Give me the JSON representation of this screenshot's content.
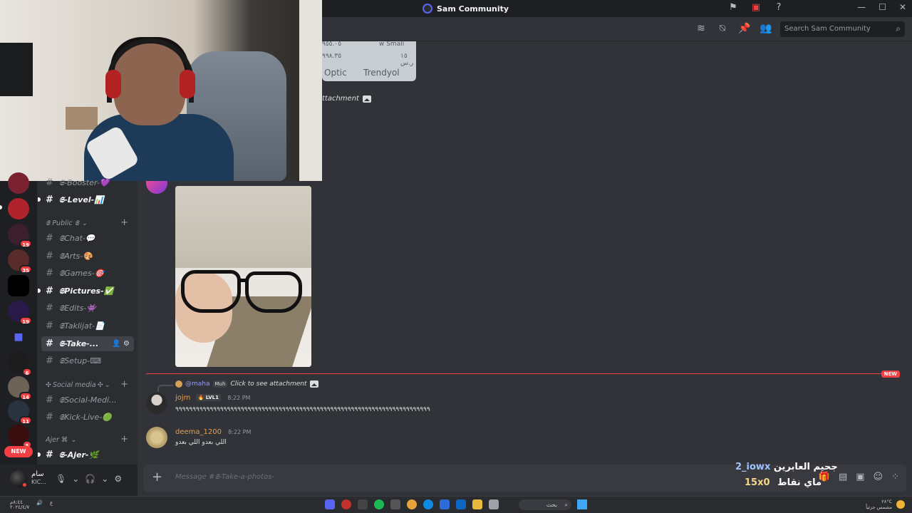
{
  "window": {
    "title": "Sam Community"
  },
  "header": {
    "search_placeholder": "Search Sam Community"
  },
  "top_card": {
    "line1_left": "٩٥٥.٠٥",
    "line1_right": "w Small",
    "line2_left": "٩٩٨.٣٥",
    "line2_right": "١٥ ر.س",
    "brand_left": "Optic",
    "brand_right": "Trendyol"
  },
  "top_attachment": {
    "text": "ttachment"
  },
  "sidebar": {
    "channels_top": [
      {
        "label": "𝕾-Booster-",
        "emoji": "💜"
      },
      {
        "label": "𝕾-Level-",
        "emoji": "📊"
      }
    ],
    "category_public": "𝕾 Public 𝕾",
    "public_channels": [
      {
        "label": "𝕾Chat-",
        "emoji": "💬"
      },
      {
        "label": "𝕾Arts-",
        "emoji": "🎨"
      },
      {
        "label": "𝕾Games-",
        "emoji": "🎯"
      },
      {
        "label": "𝕾Pictures-",
        "emoji": "✅"
      },
      {
        "label": "𝕾Edits-",
        "emoji": "👾"
      },
      {
        "label": "𝕾Taklijat-",
        "emoji": "📄"
      },
      {
        "label": "𝕾-Take-..."
      },
      {
        "label": "𝕾Setup-",
        "emoji": "⌨"
      }
    ],
    "category_social": "Social media",
    "social_channels": [
      {
        "label": "𝕾Social-Medi..."
      },
      {
        "label": "𝕾Kick-Live-",
        "emoji": "🟢"
      }
    ],
    "category_ajer": "Ajer ⌘",
    "ajer_channels": [
      {
        "label": "𝕾-Ajer-",
        "emoji": "🌿"
      }
    ]
  },
  "servers": {
    "badges": [
      "19",
      "35",
      "19",
      "6",
      "14",
      "11",
      "5"
    ],
    "new_label": "NEW"
  },
  "user_panel": {
    "name": "سام",
    "sub": "KIC..."
  },
  "messages": {
    "new_marker": "NEW",
    "reply": {
      "mention": "@maha",
      "tag": "Muh",
      "text": "Click to see attachment"
    },
    "items": [
      {
        "author": "jojm",
        "level": "LVL1",
        "time": "8:22 PM",
        "content": "٩٩٩٩٩٩٩٩٩٩٩٩٩٩٩٩٩٩٩٩٩٩٩٩٩٩٩٩٩٩٩٩٩٩٩٩٩٩٩٩٩٩٩٩٩٩٩٩٩٩٩٩٩٩٩٩٩٩٩٩٩٩٩٩٩٩٩٩٩٩٩٩٩٩"
      },
      {
        "author": "deema_1200",
        "time": "8:22 PM",
        "content": "اللي بعدو اللي بعدو"
      }
    ]
  },
  "composer": {
    "placeholder": "Message #𝕾-Take-a-photos-"
  },
  "overlay": {
    "line1_blue": "2_iowx",
    "line1_text": "جحيم العابرين",
    "line2_value": "15x0",
    "line2_text": "ماي نقاط"
  },
  "taskbar": {
    "search_text": "بحث",
    "left_time": "٨:٤٤م",
    "left_date": "٢٠٢٤/٤/٧",
    "right_line1": "٢٨°C",
    "right_line2": "مشمس جزئياً"
  },
  "colors": {
    "accent": "#5865f2",
    "danger": "#f23f43",
    "bg": "#313338"
  }
}
